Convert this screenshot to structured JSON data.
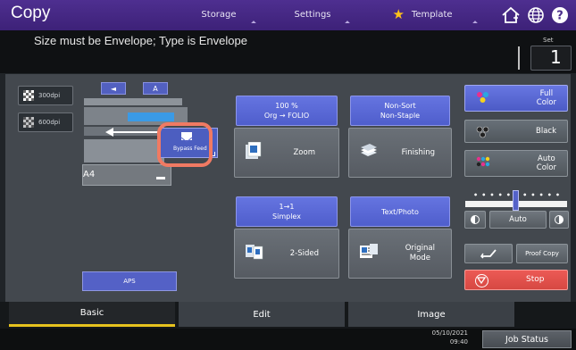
{
  "header": {
    "title": "Copy",
    "tabs": [
      "Storage",
      "Settings",
      "Template"
    ]
  },
  "message": "Size must be Envelope; Type is Envelope",
  "set": {
    "label": "Set",
    "value": "1"
  },
  "resolution": [
    "300dpi",
    "600dpi"
  ],
  "paper": {
    "size": "A4",
    "bypass_label": "Bypass Feed",
    "aps_label": "APS"
  },
  "functions": {
    "zoom": {
      "header_line1": "100 %",
      "header_line2": "Org → FOLIO",
      "label": "Zoom"
    },
    "finishing": {
      "header_line1": "Non-Sort",
      "header_line2": "Non-Staple",
      "label": "Finishing"
    },
    "duplex": {
      "header_line1": "1→1",
      "header_line2": "Simplex",
      "label": "2-Sided"
    },
    "original": {
      "header_line1": "Text/Photo",
      "label_line1": "Original",
      "label_line2": "Mode"
    }
  },
  "color_modes": {
    "full": {
      "line1": "Full",
      "line2": "Color"
    },
    "black": "Black",
    "auto": {
      "line1": "Auto",
      "line2": "Color"
    }
  },
  "exposure": {
    "auto_label": "Auto",
    "level": 0.5
  },
  "proof_copy": "Proof Copy",
  "stop": "Stop",
  "bottom_tabs": [
    "Basic",
    "Edit",
    "Image"
  ],
  "datetime": {
    "date": "05/10/2021",
    "time": "09:40"
  },
  "job_status": "Job Status",
  "colors": {
    "accent": "#5563c9",
    "topbar": "#4a2d8a",
    "stop": "#e0504b",
    "tab_indicator": "#e6c21e"
  }
}
